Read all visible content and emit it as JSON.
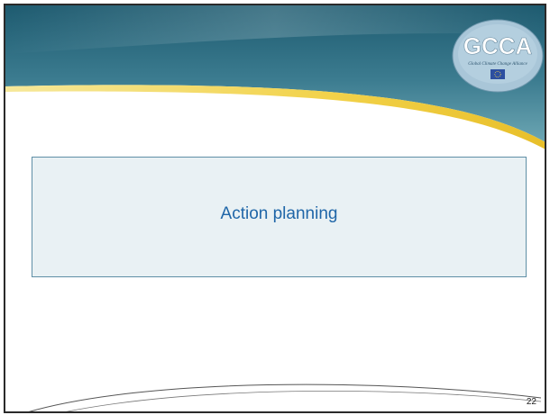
{
  "slide": {
    "title": "Action planning",
    "page_number": "22"
  },
  "logo": {
    "text": "GCCA",
    "tagline": "Global Climate Change Alliance"
  },
  "colors": {
    "header_gradient_top": "#1d5a6f",
    "header_gradient_bottom": "#6ca6b3",
    "swoosh_accent": "#f2d24a",
    "frame_border": "#2a2a2a",
    "box_fill": "#e9f1f4",
    "box_border": "#5f8fa6",
    "title_text": "#1f66a8"
  }
}
